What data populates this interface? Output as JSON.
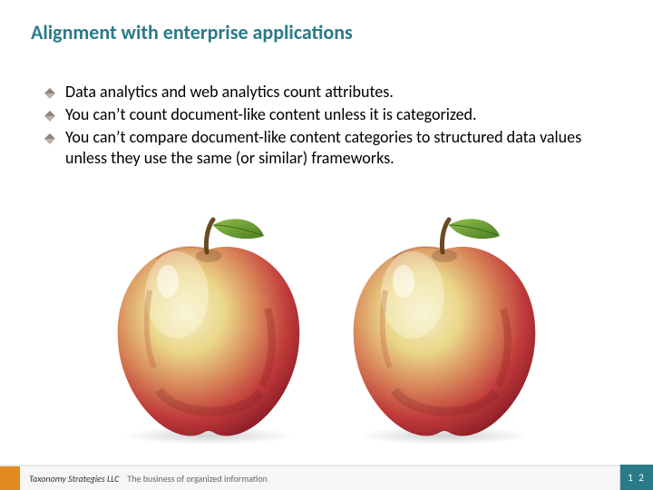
{
  "title": "Alignment with enterprise applications",
  "bullets": [
    "Data analytics and web analytics count attributes.",
    "You can’t count document-like content unless it is categorized.",
    "You can’t compare document-like content categories to structured data values unless they use the same (or similar) frameworks."
  ],
  "footer": {
    "company": "Taxonomy Strategies LLC",
    "tagline": "The business of organized information"
  },
  "page_number": "1 2"
}
